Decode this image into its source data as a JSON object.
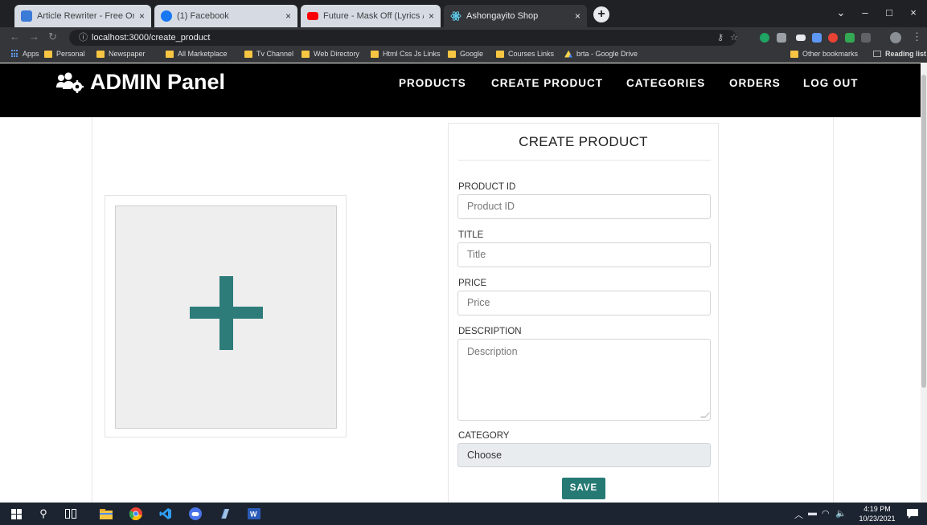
{
  "browser": {
    "tabs": [
      {
        "title": "Article Rewriter - Free Online Arti",
        "favicon_color": "#3d7bd9",
        "active": false
      },
      {
        "title": "(1) Facebook",
        "favicon_color": "#1877f2",
        "active": false
      },
      {
        "title": "Future - Mask Off (Lyrics / Lyric V",
        "favicon_color": "#ff0000",
        "active": false
      },
      {
        "title": "Ashongayito Shop",
        "favicon_color": "#61dafb",
        "active": true
      }
    ],
    "tab_close": "×",
    "new_tab": "+",
    "window_controls": {
      "dropdown": "⌄",
      "minimize": "–",
      "maximize": "□",
      "close": "×"
    },
    "url": "localhost:3000/create_product",
    "url_icon": "ⓘ",
    "bookmarks": [
      {
        "label": "Apps",
        "kind": "apps"
      },
      {
        "label": "Personal",
        "kind": "folder"
      },
      {
        "label": "Newspaper",
        "kind": "folder"
      },
      {
        "label": "All Marketplace",
        "kind": "folder"
      },
      {
        "label": "Tv Channel",
        "kind": "folder"
      },
      {
        "label": "Web Directory",
        "kind": "folder"
      },
      {
        "label": "Html Css Js Links",
        "kind": "folder"
      },
      {
        "label": "Google",
        "kind": "folder"
      },
      {
        "label": "Courses Links",
        "kind": "folder"
      },
      {
        "label": "brta - Google Drive",
        "kind": "drive"
      }
    ],
    "other_bookmarks": "Other bookmarks",
    "reading_list": "Reading list"
  },
  "navbar": {
    "brand": "ADMIN Panel",
    "brand_icon": "users-cog-icon",
    "links": [
      "PRODUCTS",
      "CREATE PRODUCT",
      "CATEGORIES",
      "ORDERS",
      "LOG OUT"
    ]
  },
  "form": {
    "title": "CREATE PRODUCT",
    "product_id_label": "PRODUCT ID",
    "product_id_placeholder": "Product ID",
    "title_label": "TITLE",
    "title_placeholder": "Title",
    "price_label": "PRICE",
    "price_placeholder": "Price",
    "description_label": "DESCRIPTION",
    "description_placeholder": "Description",
    "category_label": "CATEGORY",
    "category_selected": "Choose",
    "save_label": "SAVE"
  },
  "upload": {
    "icon": "plus-icon",
    "color": "#2d7c7a"
  },
  "taskbar": {
    "time": "4:19 PM",
    "date": "10/23/2021"
  }
}
